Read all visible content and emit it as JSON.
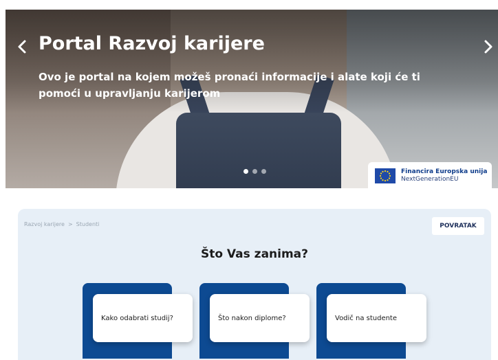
{
  "hero": {
    "title": "Portal Razvoj karijere",
    "text": "Ovo je portal na kojem možeš pronaći informacije i alate koji će ti pomoći u upravljanju karijerom",
    "prev_icon": "chevron-left-icon",
    "next_icon": "chevron-right-icon",
    "slides_total": 3,
    "active_slide": 1
  },
  "eu_badge": {
    "line1": "Financira Europska unija",
    "line2": "NextGenerationEU",
    "icon": "eu-flag-icon",
    "color": "#1f4aa8"
  },
  "panel": {
    "breadcrumb": [
      "Razvoj karijere",
      "Studenti"
    ],
    "breadcrumb_separator": ">",
    "back_label": "POVRATAK",
    "title": "Što Vas zanima?",
    "cards": [
      {
        "label": "Kako odabrati studij?"
      },
      {
        "label": "Što nakon diplome?"
      },
      {
        "label": "Vodič na studente"
      }
    ],
    "background": "#e7eff7",
    "accent": "#0d4a92"
  }
}
